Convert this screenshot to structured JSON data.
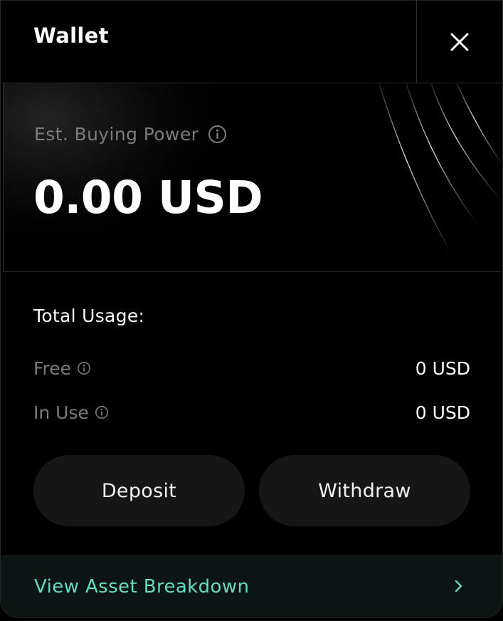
{
  "header": {
    "title": "Wallet",
    "close_icon": "close-icon"
  },
  "balance": {
    "label": "Est. Buying Power",
    "info_icon": "info-icon",
    "amount": "0.00 USD"
  },
  "usage": {
    "title": "Total Usage:",
    "rows": [
      {
        "label": "Free",
        "value": "0 USD"
      },
      {
        "label": "In Use",
        "value": "0 USD"
      }
    ]
  },
  "actions": {
    "deposit_label": "Deposit",
    "withdraw_label": "Withdraw"
  },
  "footer": {
    "breakdown_label": "View Asset Breakdown",
    "chevron_icon": "chevron-right-icon"
  },
  "colors": {
    "background": "#000000",
    "button_background": "#161616",
    "footer_background": "#0c1514",
    "accent": "#64dcc0",
    "muted_text": "#7a7a7a"
  }
}
